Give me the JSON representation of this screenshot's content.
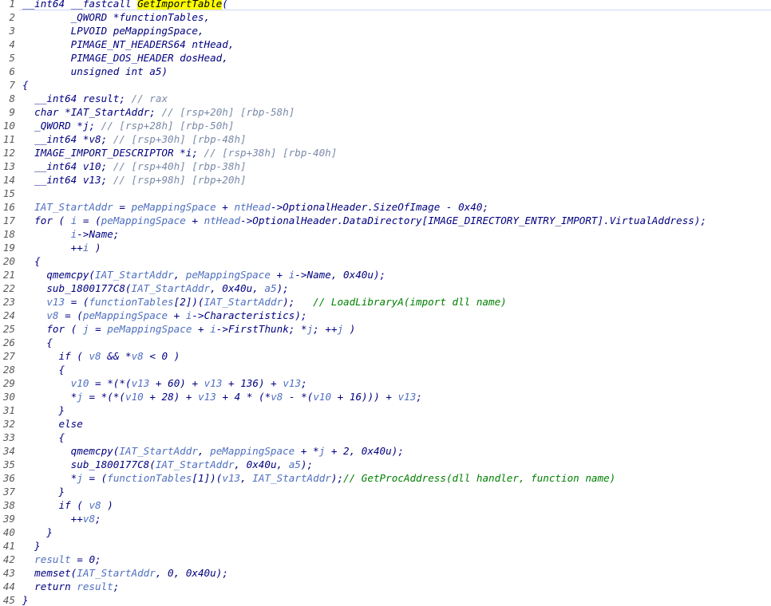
{
  "code": {
    "lines": [
      {
        "n": "1",
        "t": "__int64 __fastcall GetImportTable("
      },
      {
        "n": "2",
        "t": "        _QWORD *functionTables,"
      },
      {
        "n": "3",
        "t": "        LPVOID peMappingSpace,"
      },
      {
        "n": "4",
        "t": "        PIMAGE_NT_HEADERS64 ntHead,"
      },
      {
        "n": "5",
        "t": "        PIMAGE_DOS_HEADER dosHead,"
      },
      {
        "n": "6",
        "t": "        unsigned int a5)"
      },
      {
        "n": "7",
        "t": "{"
      },
      {
        "n": "8",
        "t": "  __int64 result; // rax"
      },
      {
        "n": "9",
        "t": "  char *IAT_StartAddr; // [rsp+20h] [rbp-58h]"
      },
      {
        "n": "10",
        "t": "  _QWORD *j; // [rsp+28h] [rbp-50h]"
      },
      {
        "n": "11",
        "t": "  __int64 *v8; // [rsp+30h] [rbp-48h]"
      },
      {
        "n": "12",
        "t": "  IMAGE_IMPORT_DESCRIPTOR *i; // [rsp+38h] [rbp-40h]"
      },
      {
        "n": "13",
        "t": "  __int64 v10; // [rsp+40h] [rbp-38h]"
      },
      {
        "n": "14",
        "t": "  __int64 v13; // [rsp+98h] [rbp+20h]"
      },
      {
        "n": "15",
        "t": ""
      },
      {
        "n": "16",
        "t": "  IAT_StartAddr = peMappingSpace + ntHead->OptionalHeader.SizeOfImage - 0x40;"
      },
      {
        "n": "17",
        "t": "  for ( i = (peMappingSpace + ntHead->OptionalHeader.DataDirectory[IMAGE_DIRECTORY_ENTRY_IMPORT].VirtualAddress);"
      },
      {
        "n": "18",
        "t": "        i->Name;"
      },
      {
        "n": "19",
        "t": "        ++i )"
      },
      {
        "n": "20",
        "t": "  {"
      },
      {
        "n": "21",
        "t": "    qmemcpy(IAT_StartAddr, peMappingSpace + i->Name, 0x40u);"
      },
      {
        "n": "22",
        "t": "    sub_1800177C8(IAT_StartAddr, 0x40u, a5);"
      },
      {
        "n": "23",
        "t": "    v13 = (functionTables[2])(IAT_StartAddr);   // LoadLibraryA(import dll name)"
      },
      {
        "n": "24",
        "t": "    v8 = (peMappingSpace + i->Characteristics);"
      },
      {
        "n": "25",
        "t": "    for ( j = peMappingSpace + i->FirstThunk; *j; ++j )"
      },
      {
        "n": "26",
        "t": "    {"
      },
      {
        "n": "27",
        "t": "      if ( v8 && *v8 < 0 )"
      },
      {
        "n": "28",
        "t": "      {"
      },
      {
        "n": "29",
        "t": "        v10 = *(*(v13 + 60) + v13 + 136) + v13;"
      },
      {
        "n": "30",
        "t": "        *j = *(*(v10 + 28) + v13 + 4 * (*v8 - *(v10 + 16))) + v13;"
      },
      {
        "n": "31",
        "t": "      }"
      },
      {
        "n": "32",
        "t": "      else"
      },
      {
        "n": "33",
        "t": "      {"
      },
      {
        "n": "34",
        "t": "        qmemcpy(IAT_StartAddr, peMappingSpace + *j + 2, 0x40u);"
      },
      {
        "n": "35",
        "t": "        sub_1800177C8(IAT_StartAddr, 0x40u, a5);"
      },
      {
        "n": "36",
        "t": "        *j = (functionTables[1])(v13, IAT_StartAddr);// GetProcAddress(dll handler, function name)"
      },
      {
        "n": "37",
        "t": "      }"
      },
      {
        "n": "38",
        "t": "      if ( v8 )"
      },
      {
        "n": "39",
        "t": "        ++v8;"
      },
      {
        "n": "40",
        "t": "    }"
      },
      {
        "n": "41",
        "t": "  }"
      },
      {
        "n": "42",
        "t": "  result = 0;"
      },
      {
        "n": "43",
        "t": "  memset(IAT_StartAddr, 0, 0x40u);"
      },
      {
        "n": "44",
        "t": "  return result;"
      },
      {
        "n": "45",
        "t": "}"
      }
    ]
  },
  "highlight": {
    "function_name": "GetImportTable"
  },
  "colors": {
    "background": "#ffffff",
    "code_default": "#000080",
    "variables": "#4f6fbf",
    "comments_gray": "#7a8aa8",
    "comments_green": "#008000",
    "line_numbers": "#5a5a5a",
    "highlight": "#ffff00"
  }
}
